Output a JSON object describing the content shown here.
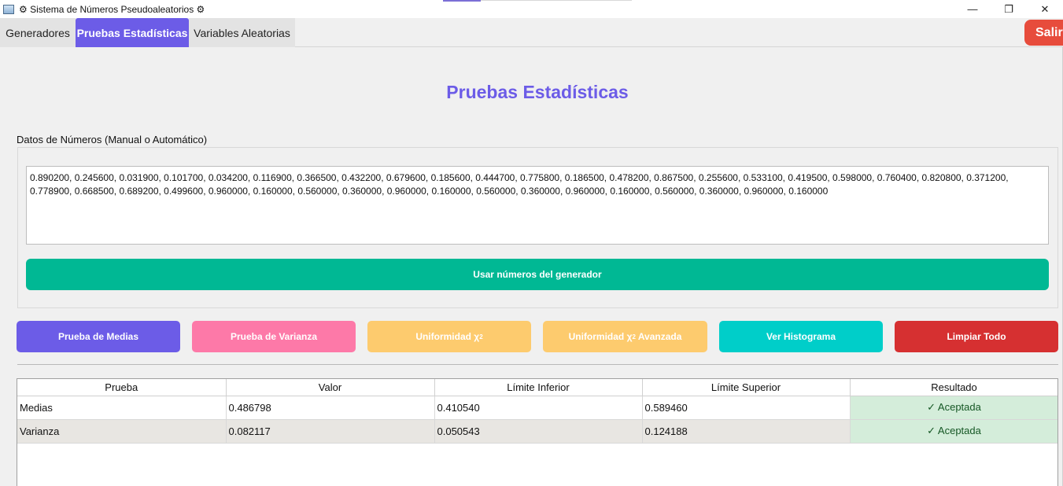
{
  "window": {
    "title": "⚙ Sistema de Números Pseudoaleatorios ⚙",
    "controls": {
      "minimize": "—",
      "restore": "❐",
      "close": "✕"
    }
  },
  "tabs": [
    {
      "label": "Generadores",
      "active": false
    },
    {
      "label": "Pruebas Estadísticas",
      "active": true
    },
    {
      "label": "Variables Aleatorias",
      "active": false
    }
  ],
  "exit_label": "Salir",
  "page_title": "Pruebas Estadísticas",
  "data_group": {
    "label": "Datos de Números (Manual o Automático)",
    "numbers_text": "0.890200, 0.245600, 0.031900, 0.101700, 0.034200, 0.116900, 0.366500, 0.432200, 0.679600, 0.185600, 0.444700, 0.775800, 0.186500, 0.478200, 0.867500, 0.255600, 0.533100, 0.419500, 0.598000, 0.760400, 0.820800, 0.371200, 0.778900, 0.668500, 0.689200, 0.499600, 0.960000, 0.160000, 0.560000, 0.360000, 0.960000, 0.160000, 0.560000, 0.360000, 0.960000, 0.160000, 0.560000, 0.360000, 0.960000, 0.160000",
    "use_generator_label": "Usar números del generador"
  },
  "actions": {
    "medias": "Prueba de Medias",
    "varianza": "Prueba de Varianza",
    "uniformidad": "Uniformidad χ",
    "uniformidad_avanzada_pre": "Uniformidad χ",
    "uniformidad_avanzada_post": " Avanzada",
    "superscript": "2",
    "histograma": "Ver Histograma",
    "limpiar": "Limpiar Todo"
  },
  "colors": {
    "accent": "#6c5ce7",
    "medias": "#6c5ce7",
    "varianza": "#fd79a8",
    "uniformidad": "#fdcb6e",
    "histograma": "#00cec9",
    "limpiar": "#d63031",
    "generator": "#00b894",
    "exit": "#e74c3c"
  },
  "results_table": {
    "headers": [
      "Prueba",
      "Valor",
      "Límite Inferior",
      "Límite Superior",
      "Resultado"
    ],
    "rows": [
      [
        "Medias",
        "0.486798",
        "0.410540",
        "0.589460",
        "✓ Aceptada"
      ],
      [
        "Varianza",
        "0.082117",
        "0.050543",
        "0.124188",
        "✓ Aceptada"
      ]
    ]
  }
}
